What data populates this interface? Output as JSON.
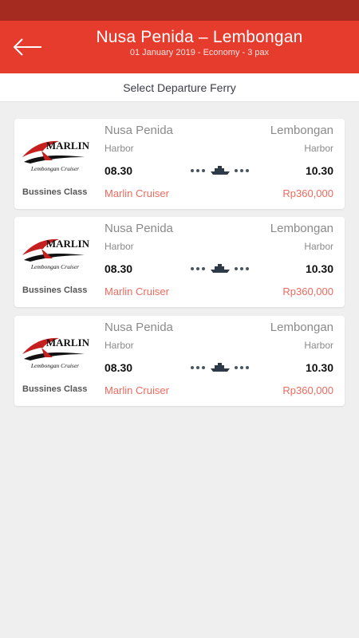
{
  "header": {
    "title": "Nusa Penida – Lembongan",
    "subtitle": "01 January 2019 - Economy - 3 pax",
    "back_icon": "arrow-left-icon"
  },
  "section": {
    "label": "Select Departure Ferry"
  },
  "colors": {
    "status_bar": "#a52a1f",
    "app_bar": "#e63c2e",
    "accent_text": "#ef6a5e",
    "background": "#efefef"
  },
  "ferries": [
    {
      "logo_text": "MARLIN",
      "logo_subtext": "Lembongan Cruiser",
      "class": "Bussines Class",
      "from_city": "Nusa Penida",
      "from_harbor": "Harbor",
      "to_city": "Lembongan",
      "to_harbor": "Harbor",
      "departure": "08.30",
      "arrival": "10.30",
      "operator": "Marlin Cruiser",
      "price": "Rp360,000",
      "route_icon": "ferry-icon"
    },
    {
      "logo_text": "MARLIN",
      "logo_subtext": "Lembongan Cruiser",
      "class": "Bussines Class",
      "from_city": "Nusa Penida",
      "from_harbor": "Harbor",
      "to_city": "Lembongan",
      "to_harbor": "Harbor",
      "departure": "08.30",
      "arrival": "10.30",
      "operator": "Marlin Cruiser",
      "price": "Rp360,000",
      "route_icon": "ferry-icon"
    },
    {
      "logo_text": "MARLIN",
      "logo_subtext": "Lembongan Cruiser",
      "class": "Bussines Class",
      "from_city": "Nusa Penida",
      "from_harbor": "Harbor",
      "to_city": "Lembongan",
      "to_harbor": "Harbor",
      "departure": "08.30",
      "arrival": "10.30",
      "operator": "Marlin Cruiser",
      "price": "Rp360,000",
      "route_icon": "ferry-icon"
    }
  ]
}
